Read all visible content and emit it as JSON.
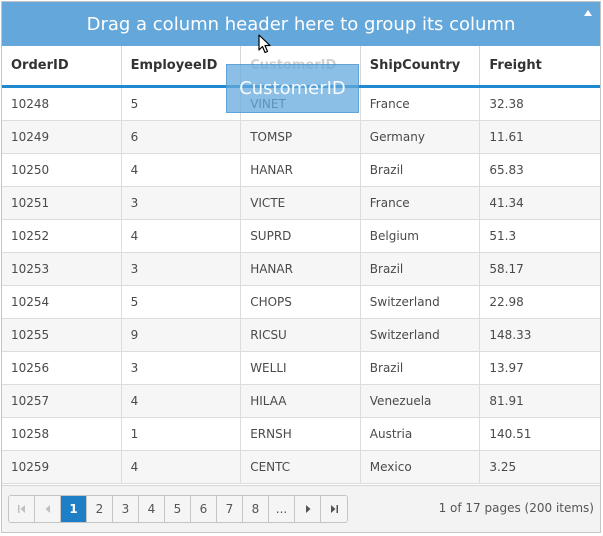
{
  "group_area": {
    "text": "Drag a column header here to group its column",
    "toggle_icon": "triangle-up-icon"
  },
  "columns": [
    {
      "label": "OrderID"
    },
    {
      "label": "EmployeeID"
    },
    {
      "label": "CustomerID"
    },
    {
      "label": "ShipCountry"
    },
    {
      "label": "Freight"
    }
  ],
  "drag_clone": {
    "label": "CustomerID"
  },
  "rows": [
    [
      "10248",
      "5",
      "VINET",
      "France",
      "32.38"
    ],
    [
      "10249",
      "6",
      "TOMSP",
      "Germany",
      "11.61"
    ],
    [
      "10250",
      "4",
      "HANAR",
      "Brazil",
      "65.83"
    ],
    [
      "10251",
      "3",
      "VICTE",
      "France",
      "41.34"
    ],
    [
      "10252",
      "4",
      "SUPRD",
      "Belgium",
      "51.3"
    ],
    [
      "10253",
      "3",
      "HANAR",
      "Brazil",
      "58.17"
    ],
    [
      "10254",
      "5",
      "CHOPS",
      "Switzerland",
      "22.98"
    ],
    [
      "10255",
      "9",
      "RICSU",
      "Switzerland",
      "148.33"
    ],
    [
      "10256",
      "3",
      "WELLI",
      "Brazil",
      "13.97"
    ],
    [
      "10257",
      "4",
      "HILAA",
      "Venezuela",
      "81.91"
    ],
    [
      "10258",
      "1",
      "ERNSH",
      "Austria",
      "140.51"
    ],
    [
      "10259",
      "4",
      "CENTC",
      "Mexico",
      "3.25"
    ]
  ],
  "pager": {
    "first_icon": "first-page-icon",
    "prev_icon": "prev-page-icon",
    "pages": [
      "1",
      "2",
      "3",
      "4",
      "5",
      "6",
      "7",
      "8",
      "..."
    ],
    "next_icon": "next-page-icon",
    "last_icon": "last-page-icon",
    "info": "1 of 17 pages (200 items)"
  },
  "colors": {
    "group_area_bg": "#64a7da",
    "accent": "#1f8ad0",
    "active_page": "#1f7fc6"
  }
}
